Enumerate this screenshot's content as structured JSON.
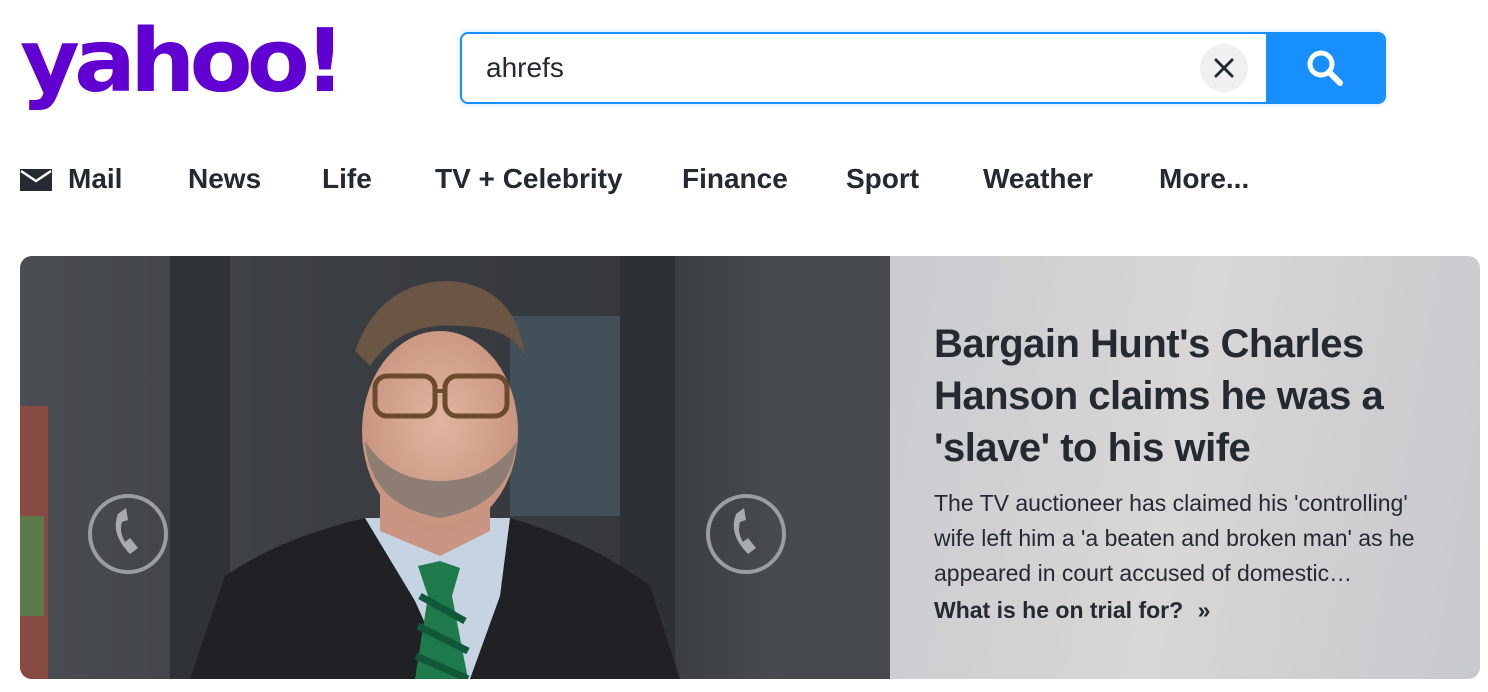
{
  "brand": {
    "logo_text": "yahoo!",
    "logo_color": "#6001d2",
    "accent": "#188fff"
  },
  "search": {
    "value": "ahrefs",
    "clear_icon": "close-icon",
    "submit_icon": "search-icon"
  },
  "nav": {
    "items": [
      {
        "label": "Mail",
        "icon": "mail-icon"
      },
      {
        "label": "News"
      },
      {
        "label": "Life"
      },
      {
        "label": "TV + Celebrity"
      },
      {
        "label": "Finance"
      },
      {
        "label": "Sport"
      },
      {
        "label": "Weather"
      },
      {
        "label": "More..."
      }
    ]
  },
  "hero": {
    "headline": "Bargain Hunt's Charles Hanson claims he was a 'slave' to his wife",
    "summary": "The TV auctioneer has claimed his 'controlling' wife left him a 'a beaten and broken man' as he appeared in court accused of domestic…",
    "link_label": "What is he on trial for?",
    "link_arrow": "»"
  }
}
